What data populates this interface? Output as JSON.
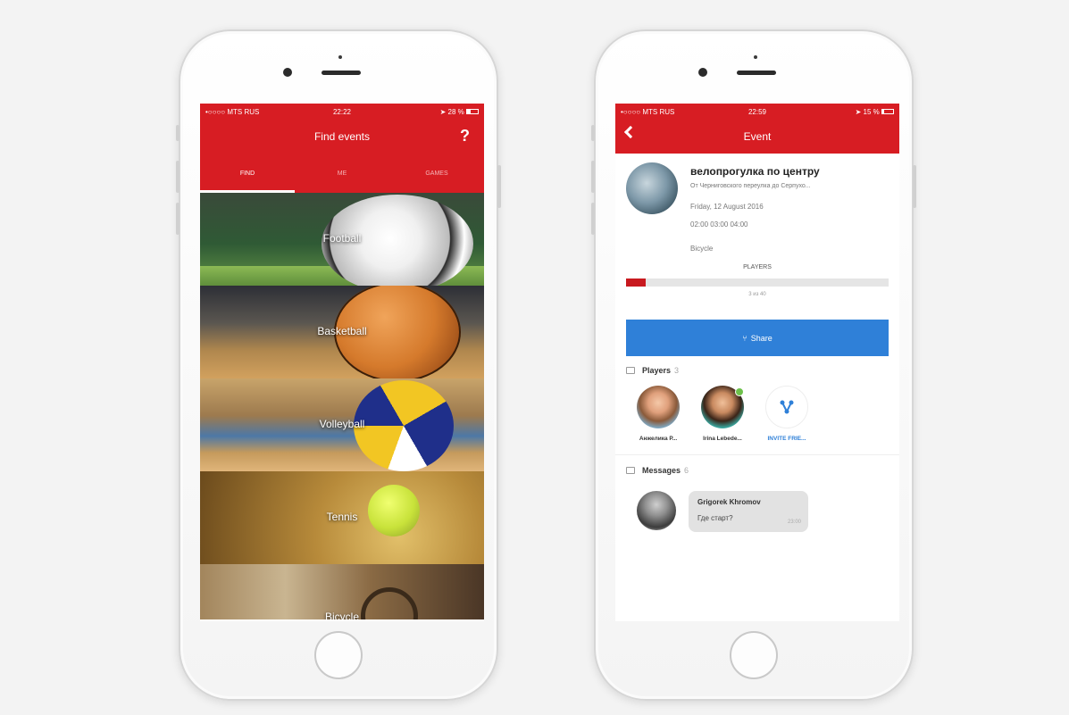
{
  "left_phone": {
    "status": {
      "carrier": "•○○○○ MTS RUS",
      "time": "22:22",
      "battery": "28 %"
    },
    "nav": {
      "title": "Find events",
      "help_label": "?"
    },
    "tabs": [
      {
        "label": "FIND",
        "active": true
      },
      {
        "label": "ME",
        "active": false
      },
      {
        "label": "GAMES",
        "active": false
      }
    ],
    "sports": [
      {
        "label": "Football",
        "icon": "soccer-ball-icon"
      },
      {
        "label": "Basketball",
        "icon": "basketball-icon"
      },
      {
        "label": "Volleyball",
        "icon": "volleyball-icon"
      },
      {
        "label": "Tennis",
        "icon": "tennis-ball-icon"
      },
      {
        "label": "Bicycle",
        "icon": "bicycle-icon"
      }
    ]
  },
  "right_phone": {
    "status": {
      "carrier": "•○○○○ MTS RUS",
      "time": "22:59",
      "battery": "15 %"
    },
    "nav": {
      "title": "Event"
    },
    "event": {
      "title": "велопрогулка по центру",
      "route": "От Черниговского переулка до Серпухо...",
      "date": "Friday, 12 August 2016",
      "times": "02:00 03:00 04:00",
      "type": "Bicycle",
      "players_label": "PLAYERS",
      "progress_fraction": 0.075,
      "progress_text": "3 из 40"
    },
    "share_label": "Share",
    "players_section": {
      "title": "Players",
      "count": "3"
    },
    "players": [
      {
        "name": "Анжелика Р...",
        "online": false
      },
      {
        "name": "Irina Lebede...",
        "online": true
      }
    ],
    "invite_label": "INVITE FRIE...",
    "messages_section": {
      "title": "Messages",
      "count": "6"
    },
    "message": {
      "author": "Grigorek Khromov",
      "text": "Где старт?",
      "time": "23:00"
    }
  },
  "colors": {
    "brand_red": "#d71d23",
    "share_blue": "#2f80d8",
    "online_green": "#6dc04b"
  }
}
